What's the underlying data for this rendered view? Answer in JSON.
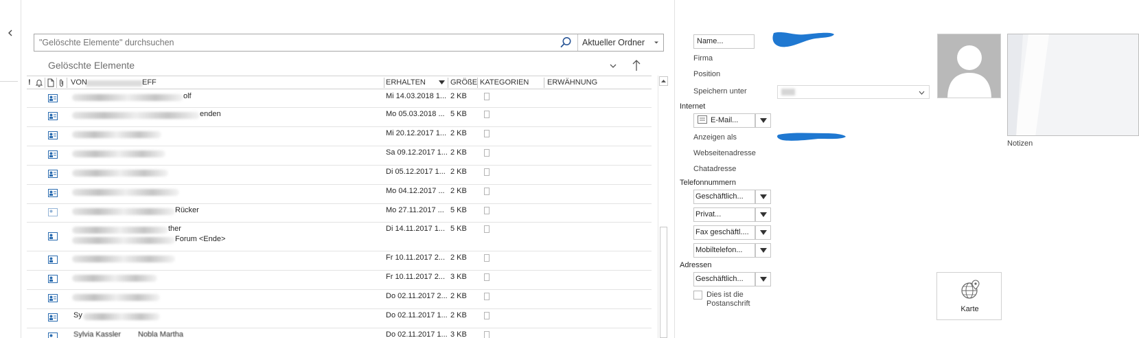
{
  "search": {
    "placeholder": "\"Gelöschte Elemente\" durchsuchen",
    "scope": "Aktueller Ordner"
  },
  "folder": {
    "title": "Gelöschte Elemente"
  },
  "columns": {
    "from_subject": "VON",
    "subject_tail": "EFF",
    "received": "ERHALTEN",
    "size": "GRÖßE",
    "categories": "KATEGORIEN",
    "mention": "ERWÄHNUNG"
  },
  "rows": [
    {
      "name_suffix": "olf",
      "received": "Mi 14.03.2018 1...",
      "size": "2 KB"
    },
    {
      "name_suffix": "enden",
      "received": "Mo 05.03.2018 ...",
      "size": "5 KB"
    },
    {
      "name_suffix": "",
      "received": "Mi 20.12.2017 1...",
      "size": "2 KB"
    },
    {
      "name_suffix": "",
      "received": "Sa 09.12.2017 1...",
      "size": "2 KB"
    },
    {
      "name_suffix": "",
      "received": "Di 05.12.2017 1...",
      "size": "2 KB"
    },
    {
      "name_suffix": "",
      "received": "Mo 04.12.2017 ...",
      "size": "2 KB"
    },
    {
      "name_suffix": "Rücker",
      "received": "Mo 27.11.2017 ...",
      "size": "5 KB"
    },
    {
      "name_suffix": "ther",
      "sub_suffix": "Forum <Ende>",
      "received": "Di 14.11.2017 1...",
      "size": "5 KB"
    },
    {
      "name_suffix": "",
      "received": "Fr 10.11.2017 2...",
      "size": "2 KB"
    },
    {
      "name_suffix": "",
      "received": "Fr 10.11.2017 2...",
      "size": "3 KB"
    },
    {
      "name_suffix": "",
      "received": "Do 02.11.2017 2...",
      "size": "2 KB"
    },
    {
      "name_prefix": "Sy",
      "name_suffix": "",
      "received": "Do 02.11.2017 1...",
      "size": "2 KB"
    },
    {
      "name_prefix": "Sylvia Kassler",
      "name_suffix": "Nobla Martha",
      "received": "Do 02.11.2017 1...",
      "size": "3 KB"
    }
  ],
  "contact": {
    "name_button": "Name...",
    "company_label": "Firma",
    "position_label": "Position",
    "save_as_label": "Speichern unter",
    "internet_section": "Internet",
    "email_button": "E-Mail...",
    "display_as_label": "Anzeigen als",
    "website_label": "Webseitenadresse",
    "chat_label": "Chatadresse",
    "phone_section": "Telefonnummern",
    "phones": [
      "Geschäftlich...",
      "Privat...",
      "Fax geschäftl....",
      "Mobiltelefon..."
    ],
    "address_section": "Adressen",
    "address_button": "Geschäftlich...",
    "postal_line1": "Dies ist die",
    "postal_line2": "Postanschrift",
    "notes_label": "Notizen",
    "map_label": "Karte"
  },
  "colors": {
    "redaction_blue": "#1f78d1",
    "photo_gray": "#b9b9b9"
  }
}
